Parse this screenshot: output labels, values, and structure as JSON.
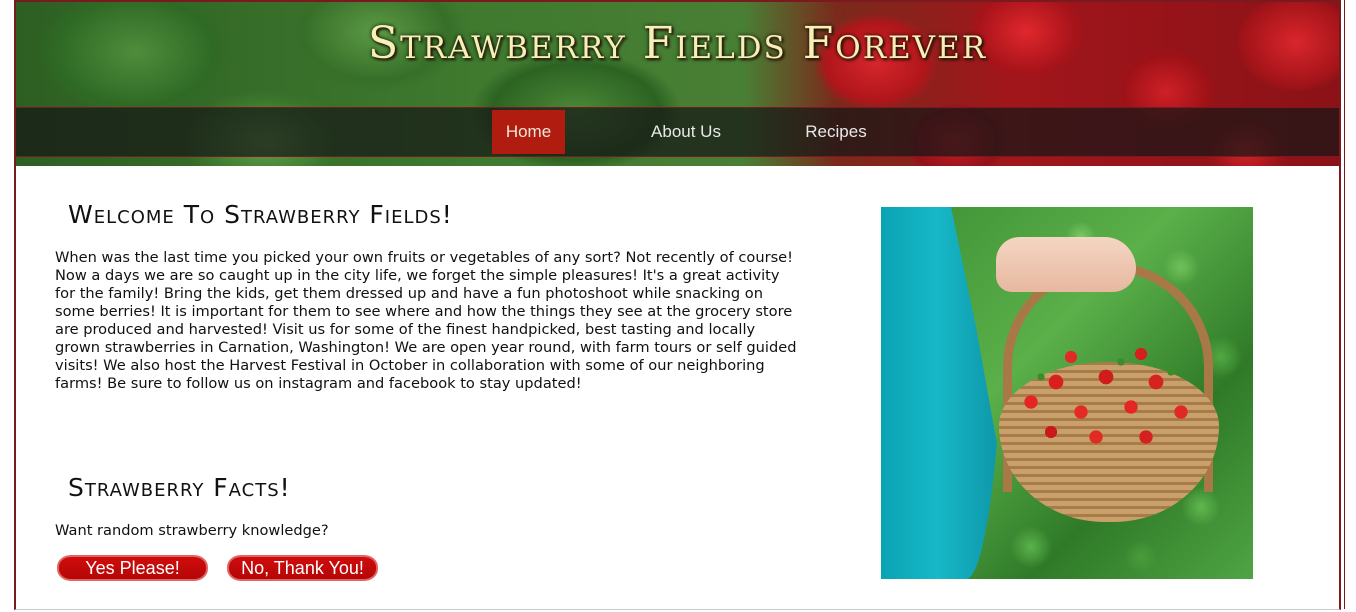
{
  "site": {
    "title": "Strawberry Fields Forever"
  },
  "nav": {
    "items": [
      {
        "label": "Home",
        "active": true
      },
      {
        "label": "About Us",
        "active": false
      },
      {
        "label": "Recipes",
        "active": false
      }
    ]
  },
  "welcome": {
    "heading": "Welcome To Strawberry Fields!",
    "body": "When was the last time you picked your own fruits or vegetables of any sort? Not recently of course! Now a days we are so caught up in the city life, we forget the simple pleasures! It's a great activity for the family! Bring the kids, get them dressed up and have a fun photoshoot while snacking on some berries! It is important for them to see where and how the things they see at the grocery store are produced and harvested! Visit us for some of the finest handpicked, best tasting and locally grown strawberries in Carnation, Washington! We are open year round, with farm tours or self guided visits! We also host the Harvest Festival in October in collaboration with some of our neighboring farms! Be sure to follow us on instagram and facebook to stay updated!"
  },
  "facts": {
    "heading": "Strawberry Facts!",
    "prompt": "Want random strawberry knowledge?",
    "yes_label": "Yes Please!",
    "no_label": "No, Thank You!"
  },
  "colors": {
    "accent": "#b01c10",
    "button": "#c90909",
    "border": "#7a1a1f",
    "title": "#f7efb5"
  }
}
